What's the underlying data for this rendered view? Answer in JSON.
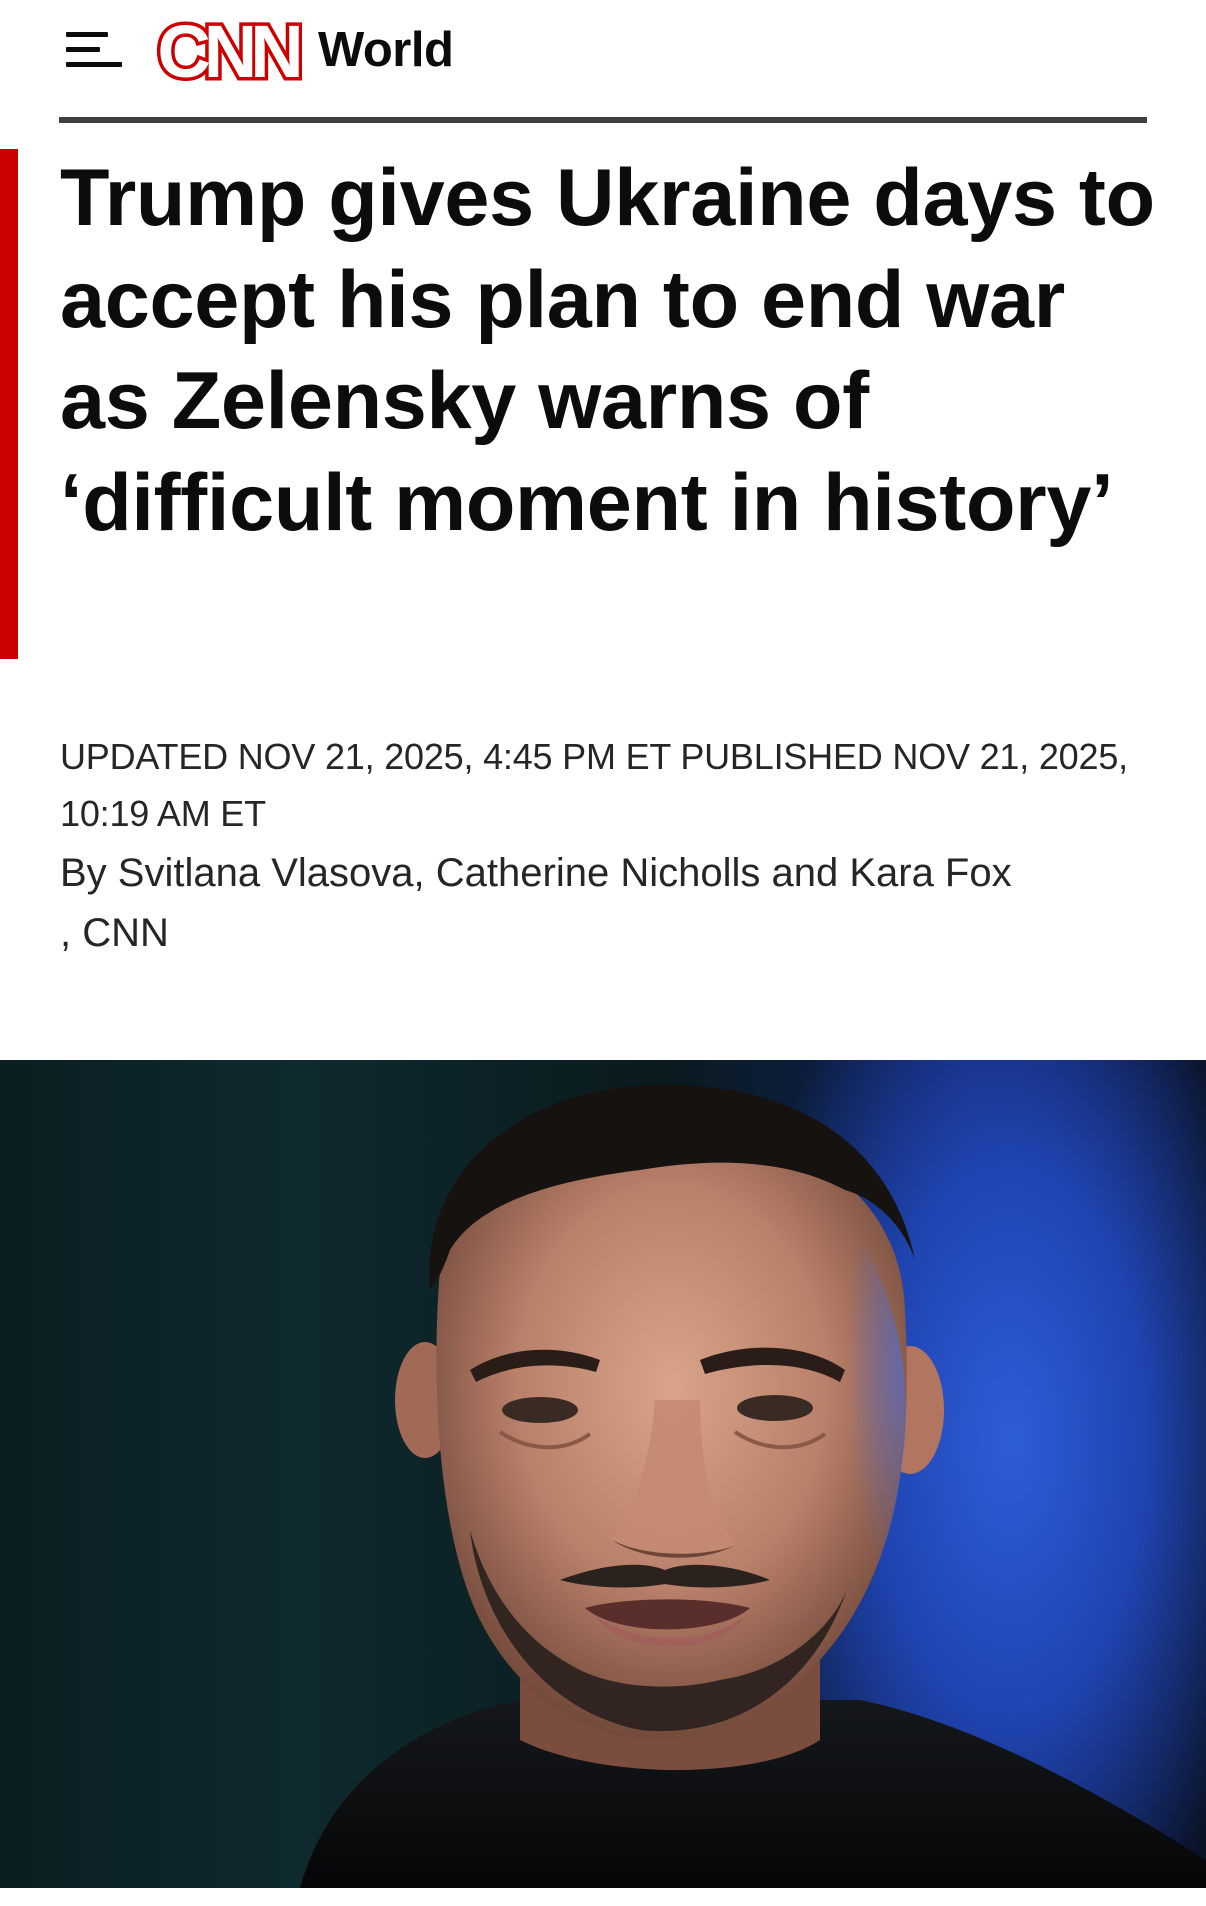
{
  "header": {
    "menu_icon": "hamburger-menu-icon",
    "logo_text": "CNN",
    "section": "World"
  },
  "article": {
    "headline": "Trump gives Ukraine days to accept his plan to end war as Zelensky warns of ‘difficult moment in history’",
    "timestamp": "UPDATED NOV 21, 2025, 4:45 PM ET PUBLISHED NOV 21, 2025, 10:19 AM ET",
    "byline": {
      "prefix": "By ",
      "author_1": "Svitlana Vlasova",
      "sep_1": ", ",
      "author_2": "Catherine Nicholls",
      "sep_2": " and ",
      "author_3": "Kara Fox",
      "suffix": ", CNN"
    }
  },
  "colors": {
    "brand_red": "#cc0000",
    "text": "#0c0c0c",
    "rule": "#404040",
    "image_blue": "#2f5dd8"
  }
}
